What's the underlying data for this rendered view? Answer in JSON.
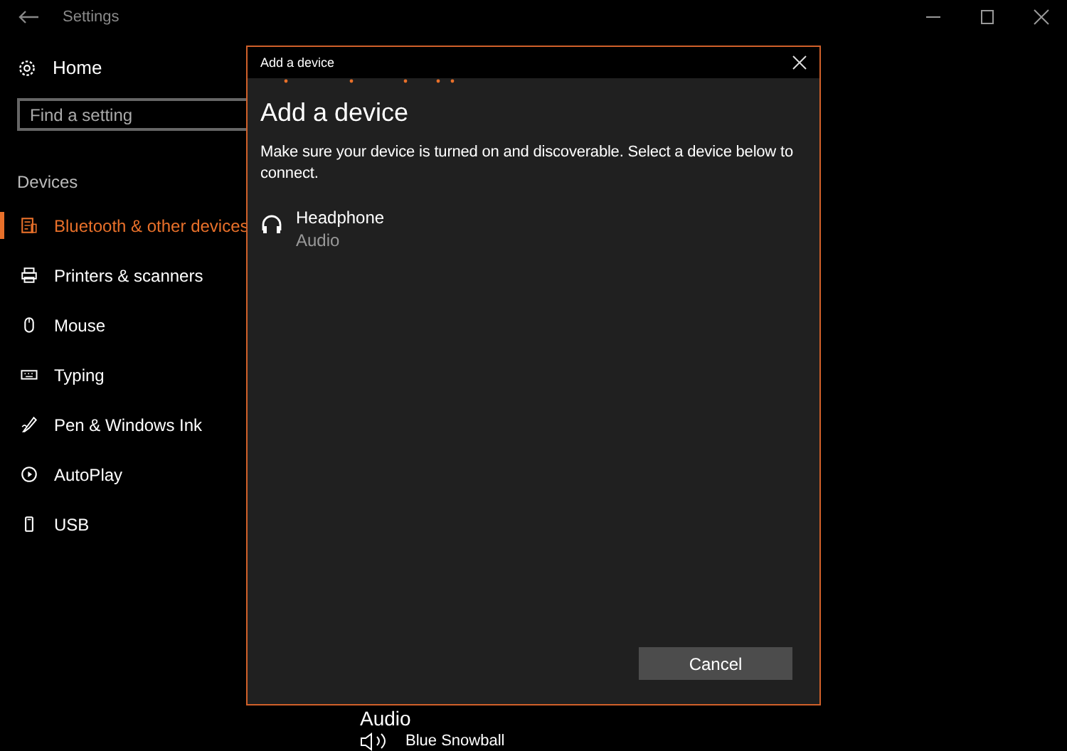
{
  "window": {
    "title": "Settings"
  },
  "sidebar": {
    "home": "Home",
    "search": {
      "placeholder": "Find a setting"
    },
    "section": "Devices",
    "items": [
      {
        "label": "Bluetooth & other devices",
        "selected": true
      },
      {
        "label": "Printers & scanners",
        "selected": false
      },
      {
        "label": "Mouse",
        "selected": false
      },
      {
        "label": "Typing",
        "selected": false
      },
      {
        "label": "Pen & Windows Ink",
        "selected": false
      },
      {
        "label": "AutoPlay",
        "selected": false
      },
      {
        "label": "USB",
        "selected": false
      }
    ]
  },
  "main": {
    "section_heading": "Audio",
    "devices": [
      {
        "name": "Blue Snowball"
      }
    ]
  },
  "dialog": {
    "title": "Add a device",
    "heading": "Add a device",
    "description": "Make sure your device is turned on and discoverable. Select a device below to connect.",
    "devices": [
      {
        "name": "Headphone",
        "type": "Audio"
      }
    ],
    "button": "Cancel"
  }
}
